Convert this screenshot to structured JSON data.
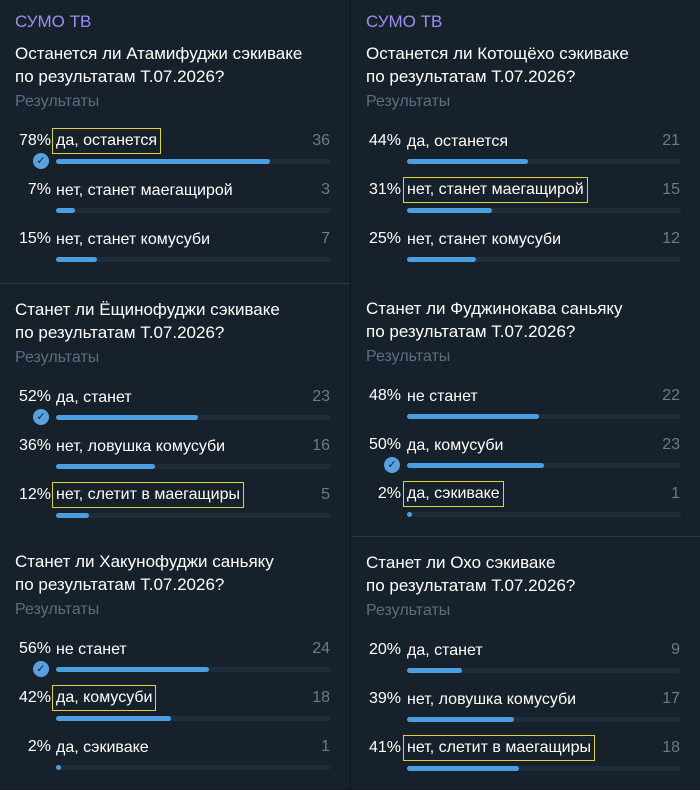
{
  "polls": [
    {
      "id": "p1",
      "channel": "СУМО ТВ",
      "question_lines": [
        "Останется ли Атамифуджи сэкиваке",
        "по результатам Т.07.2026?"
      ],
      "results_label": "Результаты",
      "options": [
        {
          "pct": "78%",
          "label": "да, останется",
          "count": "36",
          "fill": 0.78,
          "boxed": true,
          "checked": true
        },
        {
          "pct": "7%",
          "label": "нет, станет маегащирой",
          "count": "3",
          "fill": 0.07,
          "boxed": false,
          "checked": false
        },
        {
          "pct": "15%",
          "label": "нет, станет комусуби",
          "count": "7",
          "fill": 0.15,
          "boxed": false,
          "checked": false
        }
      ]
    },
    {
      "id": "p2",
      "channel": "",
      "question_lines": [
        "Станет ли Ёщинофуджи сэкиваке",
        "по результатам Т.07.2026?"
      ],
      "results_label": "Результаты",
      "options": [
        {
          "pct": "52%",
          "label": "да, станет",
          "count": "23",
          "fill": 0.52,
          "boxed": false,
          "checked": true
        },
        {
          "pct": "36%",
          "label": "нет, ловушка комусуби",
          "count": "16",
          "fill": 0.36,
          "boxed": false,
          "checked": false
        },
        {
          "pct": "12%",
          "label": "нет, слетит в маегащиры",
          "count": "5",
          "fill": 0.12,
          "boxed": true,
          "checked": false
        }
      ]
    },
    {
      "id": "p3",
      "channel": "",
      "question_lines": [
        "Станет ли Хакунофуджи саньяку",
        "по результатам Т.07.2026?"
      ],
      "results_label": "Результаты",
      "options": [
        {
          "pct": "56%",
          "label": "не станет",
          "count": "24",
          "fill": 0.56,
          "boxed": false,
          "checked": true
        },
        {
          "pct": "42%",
          "label": "да, комусуби",
          "count": "18",
          "fill": 0.42,
          "boxed": true,
          "checked": false
        },
        {
          "pct": "2%",
          "label": "да, сэкиваке",
          "count": "1",
          "fill": 0.02,
          "boxed": false,
          "checked": false
        }
      ]
    },
    {
      "id": "p4",
      "channel": "СУМО ТВ",
      "question_lines": [
        "Останется ли Котощёхо сэкиваке",
        "по результатам Т.07.2026?"
      ],
      "results_label": "Результаты",
      "options": [
        {
          "pct": "44%",
          "label": "да, останется",
          "count": "21",
          "fill": 0.44,
          "boxed": false,
          "checked": false
        },
        {
          "pct": "31%",
          "label": "нет, станет маегащирой",
          "count": "15",
          "fill": 0.31,
          "boxed": true,
          "checked": false
        },
        {
          "pct": "25%",
          "label": "нет, станет комусуби",
          "count": "12",
          "fill": 0.25,
          "boxed": false,
          "checked": false
        }
      ]
    },
    {
      "id": "p5",
      "channel": "",
      "question_lines": [
        "Станет ли Фуджинокава саньяку",
        "по результатам Т.07.2026?"
      ],
      "results_label": "Результаты",
      "options": [
        {
          "pct": "48%",
          "label": "не станет",
          "count": "22",
          "fill": 0.48,
          "boxed": false,
          "checked": false
        },
        {
          "pct": "50%",
          "label": "да, комусуби",
          "count": "23",
          "fill": 0.5,
          "boxed": false,
          "checked": true
        },
        {
          "pct": "2%",
          "label": "да, сэкиваке",
          "count": "1",
          "fill": 0.02,
          "boxed": true,
          "checked": false
        }
      ]
    },
    {
      "id": "p6",
      "channel": "",
      "question_lines": [
        "Станет ли Охо сэкиваке",
        "по результатам Т.07.2026?"
      ],
      "results_label": "Результаты",
      "options": [
        {
          "pct": "20%",
          "label": "да, станет",
          "count": "9",
          "fill": 0.2,
          "boxed": false,
          "checked": false
        },
        {
          "pct": "39%",
          "label": "нет, ловушка комусуби",
          "count": "17",
          "fill": 0.39,
          "boxed": false,
          "checked": false
        },
        {
          "pct": "41%",
          "label": "нет, слетит в маегащиры",
          "count": "18",
          "fill": 0.41,
          "boxed": true,
          "checked": false
        }
      ]
    }
  ]
}
